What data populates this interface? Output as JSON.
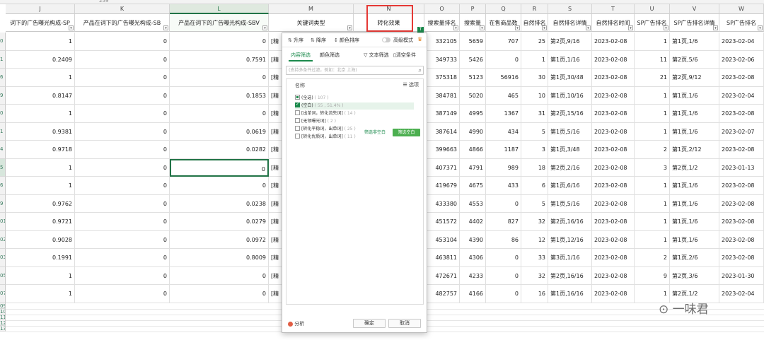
{
  "formula_bar": {
    "cell_ref": "259"
  },
  "columns": [
    {
      "letter": "J",
      "header": "词下的广告曝光构成-SP"
    },
    {
      "letter": "K",
      "header": "产品在词下的广告曝光构成-SB"
    },
    {
      "letter": "L",
      "header": "产品在词下的广告曝光构成-SBV"
    },
    {
      "letter": "M",
      "header": "关键词类型"
    },
    {
      "letter": "N",
      "header": "转化效果"
    },
    {
      "letter": "O",
      "header": "搜索量排名"
    },
    {
      "letter": "P",
      "header": "搜索量"
    },
    {
      "letter": "Q",
      "header": "在售商品数"
    },
    {
      "letter": "R",
      "header": "自然排名"
    },
    {
      "letter": "S",
      "header": "自然排名详情"
    },
    {
      "letter": "T",
      "header": "自然排名时间"
    },
    {
      "letter": "U",
      "header": "SP广告排名"
    },
    {
      "letter": "V",
      "header": "SP广告排名详情"
    },
    {
      "letter": "W",
      "header": "SP广告排名"
    }
  ],
  "rows": [
    {
      "n": "0",
      "J": "1",
      "K": "0",
      "L": "0",
      "M": "[精",
      "O": "332105",
      "P": "5659",
      "Q": "707",
      "R": "25",
      "S": "第2页,9/16",
      "T": "2023-02-08",
      "U": "1",
      "V": "第1页,1/6",
      "W": "2023-02-04"
    },
    {
      "n": "1",
      "J": "0.2409",
      "K": "0",
      "L": "0.7591",
      "M": "[精",
      "O": "349733",
      "P": "5426",
      "Q": "0",
      "R": "1",
      "S": "第1页,1/16",
      "T": "2023-02-08",
      "U": "11",
      "V": "第2页,5/6",
      "W": "2023-02-06"
    },
    {
      "n": "6",
      "J": "1",
      "K": "0",
      "L": "0",
      "M": "[精",
      "O": "375318",
      "P": "5123",
      "Q": "56916",
      "R": "30",
      "S": "第1页,30/48",
      "T": "2023-02-08",
      "U": "21",
      "V": "第2页,9/12",
      "W": "2023-02-08"
    },
    {
      "n": "9",
      "J": "0.8147",
      "K": "0",
      "L": "0.1853",
      "M": "[精",
      "O": "384781",
      "P": "5020",
      "Q": "465",
      "R": "10",
      "S": "第1页,10/16",
      "T": "2023-02-08",
      "U": "1",
      "V": "第1页,1/6",
      "W": "2023-02-04"
    },
    {
      "n": "0",
      "J": "1",
      "K": "0",
      "L": "0",
      "M": "[精",
      "O": "387149",
      "P": "4995",
      "Q": "1367",
      "R": "31",
      "S": "第2页,15/16",
      "T": "2023-02-08",
      "U": "1",
      "V": "第1页,1/6",
      "W": "2023-02-08"
    },
    {
      "n": "1",
      "J": "0.9381",
      "K": "0",
      "L": "0.0619",
      "M": "[精",
      "O": "387614",
      "P": "4990",
      "Q": "434",
      "R": "5",
      "S": "第1页,5/16",
      "T": "2023-02-08",
      "U": "1",
      "V": "第1页,1/6",
      "W": "2023-02-07"
    },
    {
      "n": "4",
      "J": "0.9718",
      "K": "0",
      "L": "0.0282",
      "M": "[精",
      "O": "399663",
      "P": "4866",
      "Q": "1187",
      "R": "3",
      "S": "第1页,3/48",
      "T": "2023-02-08",
      "U": "2",
      "V": "第1页,2/12",
      "W": "2023-02-08"
    },
    {
      "n": "5",
      "J": "1",
      "K": "0",
      "L": "0",
      "M": "[精",
      "O": "407371",
      "P": "4791",
      "Q": "989",
      "R": "18",
      "S": "第2页,2/16",
      "T": "2023-02-08",
      "U": "3",
      "V": "第2页,1/2",
      "W": "2023-01-13"
    },
    {
      "n": "6",
      "J": "1",
      "K": "0",
      "L": "0",
      "M": "[精",
      "O": "419679",
      "P": "4675",
      "Q": "433",
      "R": "6",
      "S": "第1页,6/16",
      "T": "2023-02-08",
      "U": "1",
      "V": "第1页,1/6",
      "W": "2023-02-08"
    },
    {
      "n": "9",
      "J": "0.9762",
      "K": "0",
      "L": "0.0238",
      "M": "[精",
      "O": "433380",
      "P": "4553",
      "Q": "0",
      "R": "5",
      "S": "第1页,5/16",
      "T": "2023-02-08",
      "U": "1",
      "V": "第1页,1/6",
      "W": "2023-02-08"
    },
    {
      "n": "01",
      "J": "0.9721",
      "K": "0",
      "L": "0.0279",
      "M": "[精",
      "O": "451572",
      "P": "4402",
      "Q": "827",
      "R": "32",
      "S": "第2页,16/16",
      "T": "2023-02-08",
      "U": "1",
      "V": "第1页,1/6",
      "W": "2023-02-08"
    },
    {
      "n": "02",
      "J": "0.9028",
      "K": "0",
      "L": "0.0972",
      "M": "[精",
      "O": "453104",
      "P": "4390",
      "Q": "86",
      "R": "12",
      "S": "第1页,12/16",
      "T": "2023-02-08",
      "U": "1",
      "V": "第1页,1/6",
      "W": "2023-02-08"
    },
    {
      "n": "03",
      "J": "0.1991",
      "K": "0",
      "L": "0.8009",
      "M": "[精",
      "O": "463811",
      "P": "4306",
      "Q": "0",
      "R": "33",
      "S": "第3页,1/16",
      "T": "2023-02-08",
      "U": "2",
      "V": "第1页,2/6",
      "W": "2023-02-08"
    },
    {
      "n": "05",
      "J": "1",
      "K": "0",
      "L": "0",
      "M": "[精",
      "O": "472671",
      "P": "4233",
      "Q": "0",
      "R": "32",
      "S": "第2页,16/16",
      "T": "2023-02-08",
      "U": "9",
      "V": "第2页,3/6",
      "W": "2023-01-30"
    },
    {
      "n": "07",
      "J": "1",
      "K": "0",
      "L": "0",
      "M": "[精",
      "O": "482757",
      "P": "4166",
      "Q": "0",
      "R": "16",
      "S": "第1页,16/16",
      "T": "2023-02-08",
      "U": "1",
      "V": "第2页,1/2",
      "W": "2023-02-04"
    }
  ],
  "extra_row_numbers": [
    "09",
    "10",
    "11",
    "12",
    "13"
  ],
  "filter_dialog": {
    "sort_asc": "升序",
    "sort_desc": "降序",
    "sort_color": "颜色排序",
    "advanced_mode": "高级模式",
    "tab_content": "内容筛选",
    "tab_color": "颜色筛选",
    "text_filter": "文本筛选",
    "clear_condition": "清空条件",
    "search_placeholder": "(支持多条件过滤，例如：北京  上海)",
    "list_header": "名称",
    "options_label": "选项",
    "items": [
      {
        "label": "(全选)",
        "count": "( 107 )",
        "state": "partial"
      },
      {
        "label": "(空白)",
        "count": "( 55 , 51.4% )",
        "state": "checked"
      },
      {
        "label": "[出单词，转化流失词]",
        "count": "( 14 )",
        "state": "unchecked"
      },
      {
        "label": "[无领曝光词]",
        "count": "( 2 )",
        "state": "unchecked"
      },
      {
        "label": "[转化平稳词，出单词]",
        "count": "( 25 )",
        "state": "unchecked"
      },
      {
        "label": "[转化优质词，出单词]",
        "count": "( 11 )",
        "state": "unchecked"
      }
    ],
    "filter_blank_only": "筛选非空白",
    "filter_blank": "筛选空白",
    "analyze": "分析",
    "ok": "确定",
    "cancel": "取消"
  },
  "filter_mark": "T",
  "watermark": "一味君",
  "colors": {
    "accent": "#1b8a4c",
    "highlight_box": "#e53935"
  }
}
